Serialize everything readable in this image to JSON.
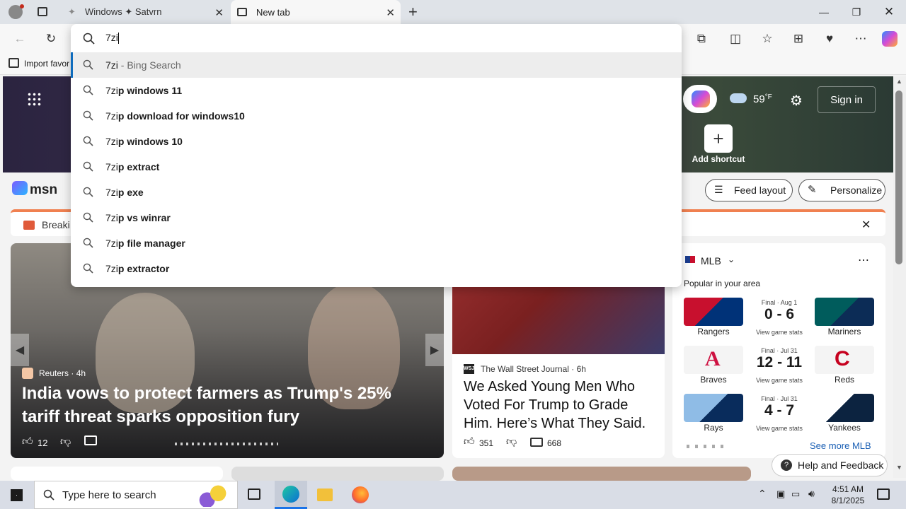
{
  "browser": {
    "tabs": [
      {
        "label": "Windows ✦ Satvrn"
      },
      {
        "label": "New tab"
      }
    ],
    "address_value": "7zi",
    "favorites_bar": {
      "import_label": "Import favor"
    }
  },
  "suggestions": [
    {
      "prefix": "7zi",
      "rest": "",
      "suffix": " - Bing Search"
    },
    {
      "prefix": "7zi",
      "rest": "p windows 11",
      "suffix": ""
    },
    {
      "prefix": "7zi",
      "rest": "p download for windows10",
      "suffix": ""
    },
    {
      "prefix": "7zi",
      "rest": "p windows 10",
      "suffix": ""
    },
    {
      "prefix": "7zi",
      "rest": "p extract",
      "suffix": ""
    },
    {
      "prefix": "7zi",
      "rest": "p exe",
      "suffix": ""
    },
    {
      "prefix": "7zi",
      "rest": "p vs winrar",
      "suffix": ""
    },
    {
      "prefix": "7zi",
      "rest": "p file manager",
      "suffix": ""
    },
    {
      "prefix": "7zi",
      "rest": "p extractor",
      "suffix": ""
    }
  ],
  "newtab": {
    "weather_temp": "59",
    "weather_unit": "°F",
    "sign_in": "Sign in",
    "add_shortcut": "Add shortcut",
    "msn_logo": "msn",
    "feed_layout": "Feed layout",
    "personalize": "Personalize",
    "breaking": "Breaki"
  },
  "hero_story": {
    "source": "Reuters",
    "age": "4h",
    "headline": "India vows to protect farmers as Trump's 25% tariff threat sparks opposition fury",
    "likes": "12"
  },
  "story2": {
    "source": "The Wall Street Journal",
    "age": "6h",
    "headline": "We Asked Young Men Who Voted For Trump to Grade Him. Here’s What They Said.",
    "likes": "351",
    "comments": "668"
  },
  "mlb": {
    "title": "MLB",
    "subtitle": "Popular in your area",
    "see_more": "See more MLB",
    "games": [
      {
        "status": "Final · Aug 1",
        "score": "0 - 6",
        "home": "Rangers",
        "away": "Mariners",
        "link": "View game stats"
      },
      {
        "status": "Final · Jul 31",
        "score": "12 - 11",
        "home": "Braves",
        "away": "Reds",
        "link": "View game stats"
      },
      {
        "status": "Final · Jul 31",
        "score": "4 - 7",
        "home": "Rays",
        "away": "Yankees",
        "link": "View game stats"
      }
    ]
  },
  "help_feedback": "Help and Feedback",
  "taskbar": {
    "search_placeholder": "Type here to search",
    "time": "4:51 AM",
    "date": "8/1/2025"
  }
}
